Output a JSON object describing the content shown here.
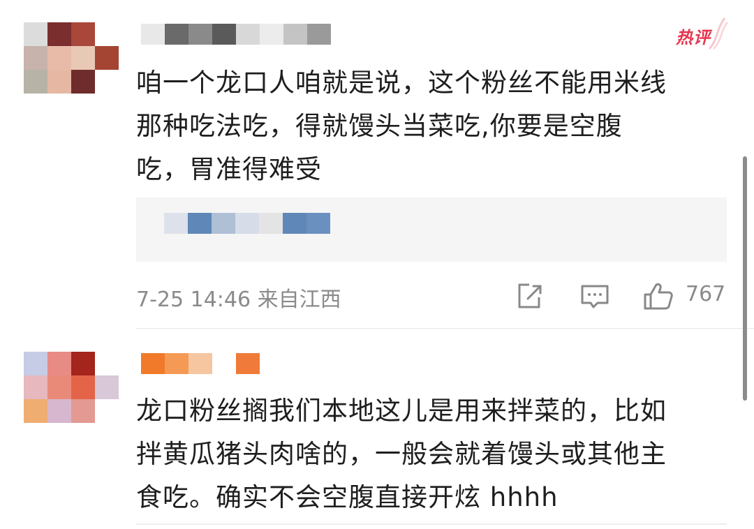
{
  "comments": [
    {
      "text": "咱一个龙口人咱就是说，这个粉丝不能用米线\n那种吃法吃，得就馒头当菜吃,你要是空腹\n吃，胃准得难受",
      "badge": "热评",
      "date": "7-25 14:46",
      "location": "来自江西",
      "likes": "767",
      "icons": [
        "share-icon",
        "comment-icon",
        "like-icon"
      ],
      "avatar_colors": [
        "#dcdcdc",
        "#7a2e2e",
        "#a8473a",
        "#ffffff",
        "#c7b3ac",
        "#e8bba9",
        "#e8c9b5",
        "#a44534",
        "#b7b3a6",
        "#e6b8a3",
        "#6e2c2c",
        "#ffffff"
      ],
      "name_colors": [
        "#e8e8e8",
        "#6a6a6a",
        "#8a8a8a",
        "#5a5a5a",
        "#d8d8d8",
        "#ececec",
        "#c4c4c4",
        "#9a9a9a"
      ],
      "quote_colors": [
        "#dde2ea",
        "#5f87b8",
        "#aebfd6",
        "#d6dde8",
        "#e4e4e4",
        "#5f87b8",
        "#6a90bf"
      ]
    },
    {
      "text": "龙口粉丝搁我们本地这儿是用来拌菜的，比如\n拌黄瓜猪头肉啥的，一般会就着馒头或其他主\n食吃。确实不会空腹直接开炫 hhhh",
      "avatar_colors": [
        "#c6cbe6",
        "#e88b85",
        "#a3251c",
        "#ffffff",
        "#e7b8be",
        "#e98a78",
        "#e4644a",
        "#d8c8d8",
        "#f0ad72",
        "#d7b7cf",
        "#e39a92",
        "#ffffff"
      ],
      "name_colors": [
        "#f07a2a",
        "#f59a55",
        "#f6c6a0",
        "#ffffff",
        "#f07a3a"
      ]
    }
  ],
  "accent_color": "#e8344e"
}
